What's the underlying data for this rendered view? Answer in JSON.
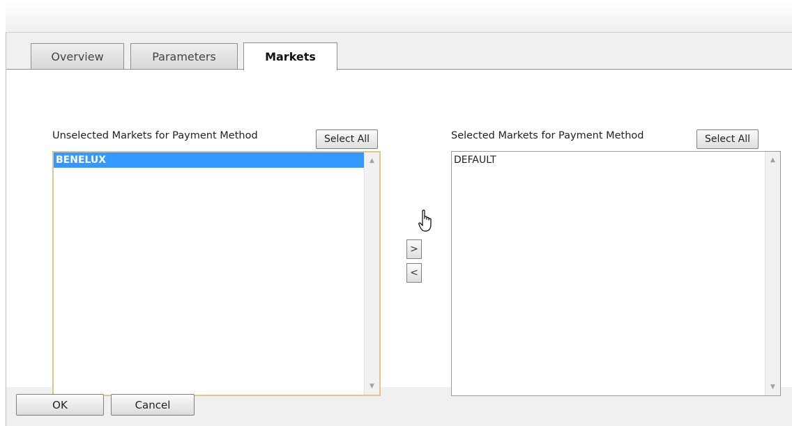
{
  "tabs": [
    {
      "label": "Overview",
      "active": false
    },
    {
      "label": "Parameters",
      "active": false
    },
    {
      "label": "Markets",
      "active": true
    }
  ],
  "unselected": {
    "label": "Unselected Markets for Payment Method",
    "select_all_label": "Select All",
    "items": [
      "BENELUX"
    ],
    "selected_item": "BENELUX"
  },
  "selected": {
    "label": "Selected Markets for Payment Method",
    "select_all_label": "Select All",
    "items": [
      "DEFAULT"
    ]
  },
  "move": {
    "add_label": ">",
    "remove_label": "<"
  },
  "footer": {
    "ok_label": "OK",
    "cancel_label": "Cancel"
  },
  "colors": {
    "selection": "#3399ff",
    "focus_border": "#e2c48d",
    "dialog_background": "#f0f0f0"
  }
}
